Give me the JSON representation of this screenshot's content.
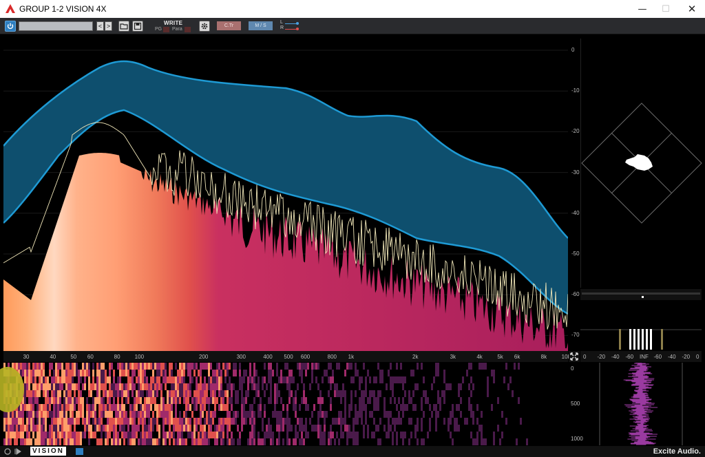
{
  "window": {
    "title": "GROUP 1-2 VISION 4X",
    "minimize": "—",
    "maximize": "☐",
    "close": "✕"
  },
  "toolbar": {
    "preset_value": "",
    "prev": "<",
    "next": ">",
    "write_label": "WRITE",
    "pg_label": "PG",
    "para_label": "Para",
    "ctr_label": "C.Tr",
    "ms_label": "M / S",
    "l_label": "L",
    "r_label": "R",
    "accent_blue": "#2f7fc0",
    "ctr_color": "#a9706f",
    "ms_color": "#5f88b0"
  },
  "spectrum": {
    "freq_labels": [
      "30",
      "40",
      "50",
      "60",
      "80",
      "100",
      "200",
      "300",
      "400",
      "500",
      "600",
      "800",
      "1k",
      "2k",
      "3k",
      "4k",
      "5k",
      "6k",
      "8k",
      "10k"
    ],
    "db_labels": [
      "0",
      "-10",
      "-20",
      "-30",
      "-40",
      "-50",
      "-60",
      "-70"
    ],
    "range_fill": "#0e4f6e",
    "range_line": "#1e8fc8",
    "peak_line": "#f0e6b8",
    "fill_color": "#a81e5c"
  },
  "goniometer": {
    "label": "vectorscope"
  },
  "correlation": {
    "scale_labels": [
      "0",
      "-20",
      "-40",
      "-60",
      "INF",
      "-60",
      "-40",
      "-20",
      "0"
    ]
  },
  "sonogram": {
    "time_labels": [
      "0",
      "500",
      "1000"
    ]
  },
  "footer": {
    "brand": "Excite Audio.",
    "logo_text": "VISION"
  }
}
